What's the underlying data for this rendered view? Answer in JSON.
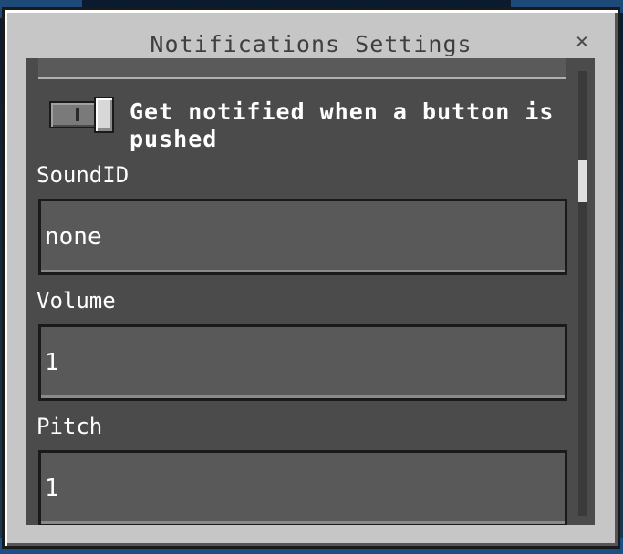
{
  "dialog": {
    "title": "Notifications Settings",
    "close_icon": "×"
  },
  "toggle": {
    "state": "off",
    "label": "Get notified when a button is pushed"
  },
  "fields": [
    {
      "label": "SoundID",
      "value": "none"
    },
    {
      "label": "Volume",
      "value": "1"
    },
    {
      "label": "Pitch",
      "value": "1"
    }
  ],
  "colors": {
    "dialog_bg": "#c6c6c6",
    "panel_bg": "#000000",
    "input_bg": "#595959",
    "text": "#ffffff"
  }
}
